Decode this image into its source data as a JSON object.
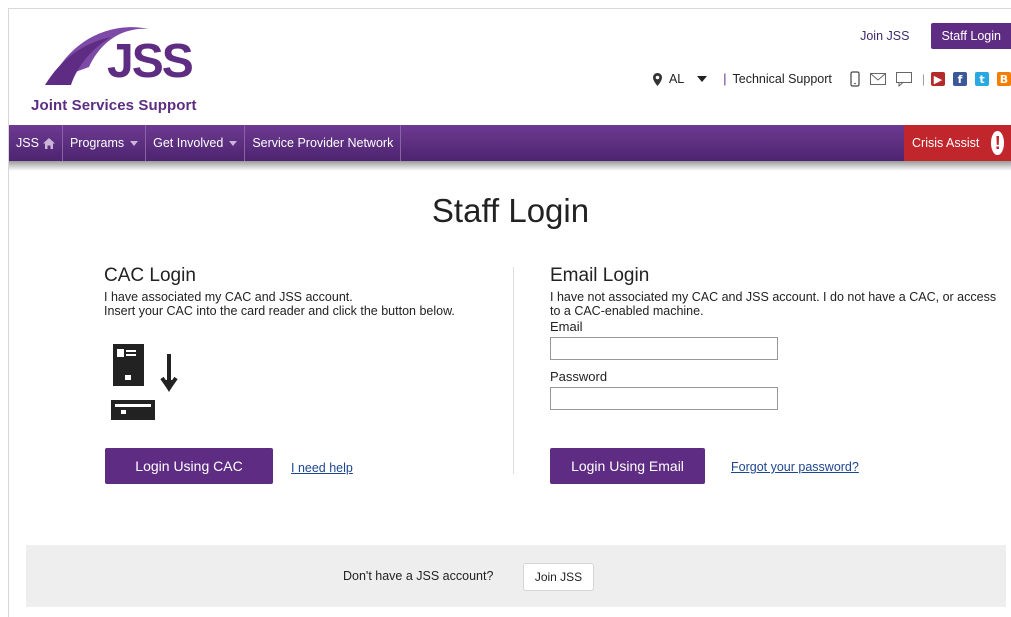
{
  "header": {
    "logo_text": "Joint Services Support",
    "logo_letters": "JSS",
    "join_link": "Join JSS",
    "staff_login": "Staff Login",
    "location": "AL",
    "tech_support": "Technical Support",
    "separator": "|"
  },
  "nav": {
    "items": [
      {
        "label": "JSS"
      },
      {
        "label": "Programs"
      },
      {
        "label": "Get Involved"
      },
      {
        "label": "Service Provider Network"
      }
    ],
    "crisis": "Crisis Assist",
    "crisis_icon": "!"
  },
  "page": {
    "title": "Staff Login"
  },
  "cac": {
    "heading": "CAC Login",
    "line1": "I have associated my CAC and JSS account.",
    "line2": "Insert your CAC into the card reader and click the button below.",
    "button": "Login Using CAC",
    "help_link": "I need help"
  },
  "email": {
    "heading": "Email Login",
    "desc": "I have not associated my CAC and JSS account. I do not have a CAC, or access to a CAC-enabled machine.",
    "email_label": "Email",
    "email_value": "",
    "password_label": "Password",
    "password_value": "",
    "button": "Login Using Email",
    "forgot_link": "Forgot your password?"
  },
  "footer": {
    "text": "Don't have a JSS account?",
    "button": "Join JSS"
  },
  "colors": {
    "brand_purple": "#5f2c83",
    "crisis_red": "#c0262c",
    "link_blue": "#1e4690"
  }
}
